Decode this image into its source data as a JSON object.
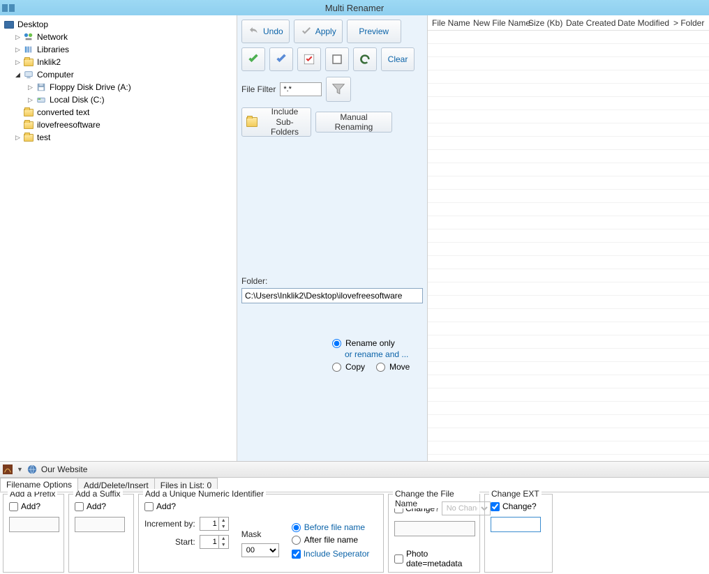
{
  "title": "Multi Renamer",
  "tree": {
    "root": "Desktop",
    "items": [
      {
        "label": "Network",
        "indent": 1,
        "toggle": "▷",
        "icon": "network"
      },
      {
        "label": "Libraries",
        "indent": 1,
        "toggle": "▷",
        "icon": "libraries"
      },
      {
        "label": "Inklik2",
        "indent": 1,
        "toggle": "▷",
        "icon": "user"
      },
      {
        "label": "Computer",
        "indent": 1,
        "toggle": "◢",
        "icon": "computer"
      },
      {
        "label": "Floppy Disk Drive (A:)",
        "indent": 2,
        "toggle": "▷",
        "icon": "floppy"
      },
      {
        "label": "Local Disk (C:)",
        "indent": 2,
        "toggle": "▷",
        "icon": "disk"
      },
      {
        "label": "converted text",
        "indent": 1,
        "toggle": "",
        "icon": "folder"
      },
      {
        "label": "ilovefreesoftware",
        "indent": 1,
        "toggle": "",
        "icon": "folder"
      },
      {
        "label": "test",
        "indent": 1,
        "toggle": "▷",
        "icon": "folder"
      }
    ]
  },
  "toolbar": {
    "undo": "Undo",
    "apply": "Apply",
    "preview": "Preview",
    "clear": "Clear",
    "filter_label": "File Filter",
    "filter_value": "*.*",
    "include_line1": "Include",
    "include_line2": "Sub-Folders",
    "manual": "Manual Renaming"
  },
  "folder": {
    "label": "Folder:",
    "path": "C:\\Users\\Inklik2\\Desktop\\ilovefreesoftware"
  },
  "rename": {
    "only": "Rename only",
    "or": "or rename and ...",
    "copy": "Copy",
    "move": "Move"
  },
  "grid": {
    "cols": [
      "File Name",
      "New File Name",
      "Size (Kb)",
      "Date Created",
      "Date Modified",
      "> Folder"
    ]
  },
  "bottombar": {
    "link": "Our Website"
  },
  "tabs": {
    "t1": "Filename Options",
    "t2": "Add/Delete/Insert",
    "t3": "Files in List: 0"
  },
  "opts": {
    "prefix": {
      "legend": "Add a Prefix",
      "add": "Add?"
    },
    "suffix": {
      "legend": "Add a Suffix",
      "add": "Add?"
    },
    "numeric": {
      "legend": "Add a Unique Numeric Identifier",
      "add": "Add?",
      "inc_label": "Increment by:",
      "inc_val": "1",
      "start_label": "Start:",
      "start_val": "1",
      "mask_label": "Mask",
      "mask_val": "00",
      "before": "Before file name",
      "after": "After file name",
      "sep": "Include Seperator"
    },
    "change": {
      "legend": "Change the File Name",
      "chk": "Change?",
      "sel": "No Change",
      "photo": "Photo date=metadata"
    },
    "ext": {
      "legend": "Change EXT",
      "chk": "Change?"
    }
  }
}
